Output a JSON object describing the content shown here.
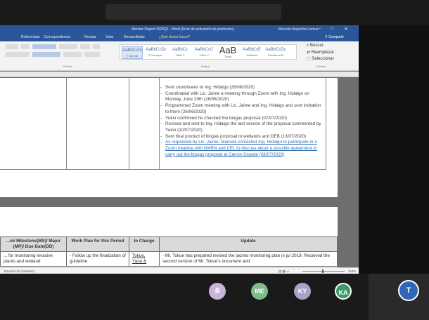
{
  "window": {
    "title": "Monitor Report 2020Q1 - Word (Error de activación de productos)",
    "user": "Marcela Alejandra Lemus",
    "minimize_glyph": "–",
    "maximize_glyph": "□",
    "close_glyph": "✕",
    "share_label": "Compartir"
  },
  "ribbon_tabs": [
    "Referencias",
    "Correspondencia",
    "Revisar",
    "Vista",
    "Desarrollador",
    "¿Qué desea hacer?"
  ],
  "ribbon": {
    "styles": [
      {
        "sample": "AaBbCcDc",
        "name": "¶ Normal"
      },
      {
        "sample": "AaBbCcDc",
        "name": "¶ Sin espa..."
      },
      {
        "sample": "AaBbCc",
        "name": "Título 1"
      },
      {
        "sample": "AaBbCcC",
        "name": "Título 2"
      },
      {
        "sample": "AaB",
        "name": "Título"
      },
      {
        "sample": "AaBbCcE",
        "name": "Subtítulo"
      },
      {
        "sample": "AaBbCcDc",
        "name": "Énfasis sutil"
      }
    ],
    "group_labels": {
      "paragraph": "Párrafo",
      "styles": "Estilos",
      "editing": "Edición"
    },
    "editing": {
      "find": "Buscar",
      "replace": "Reemplazar",
      "select": "Seleccionar"
    }
  },
  "document": {
    "bullets": [
      {
        "text": "Sent coordinates to Ing. Hidalgo (26/06/2020)",
        "color": "#444444"
      },
      {
        "text": "Coordinated with Lic. Jaime a meeting through Zoom with Ing. Hidalgo on Monday, June 29th (26/06/2020)",
        "color": "#444444"
      },
      {
        "text": "Programmed Zoom meeting with Lic. Jaime and Ing. Hidalgo and sent invitation to them (26/06/2020)",
        "color": "#444444"
      },
      {
        "text": "Yukio confirmed he checked the biogas proposal (07/07/2020)",
        "color": "#444444"
      },
      {
        "text": "Revised and sent to Ing. Hidalgo the last version of the proposal commented by Yukio (10/07/2020)",
        "color": "#444444"
      },
      {
        "text": "Sent final product of biogas proposal to wetlands and DEB (13/07/2020)",
        "color": "#444444"
      },
      {
        "text": "As requested by Lic. Jaime, Marcela contacted Ing. Hidalgo to participate in a Zoom meeting with MARN and CEL to discuss about a possible agreement to carry out the biogas proposal at Cerrón Grande (28/07/2020)",
        "color": "#2f6fb5"
      }
    ],
    "table_headers": [
      "...m/ Milestone(MS)/ Major (MP)/ Due Date(DD)",
      "Work Plan for this Period",
      "In Charge",
      "Update"
    ],
    "table_row": {
      "col1": "... for monitoring invasive plants and wetland",
      "col2": "- Follow up the finalization of guideline",
      "col3": "Tokue, Yane &",
      "col4": "- Mr. Tokue has prepared revised the jacinto monitoring plan in jul 2019. Received the second version of Mr. Tokue's document and"
    }
  },
  "statusbar": {
    "language": "Español (El Salvador)",
    "zoom": "110%"
  },
  "participants": [
    {
      "initials": "長"
    },
    {
      "initials": "ME"
    },
    {
      "initials": "KY"
    },
    {
      "initials": "KA"
    },
    {
      "initials": "T"
    }
  ]
}
